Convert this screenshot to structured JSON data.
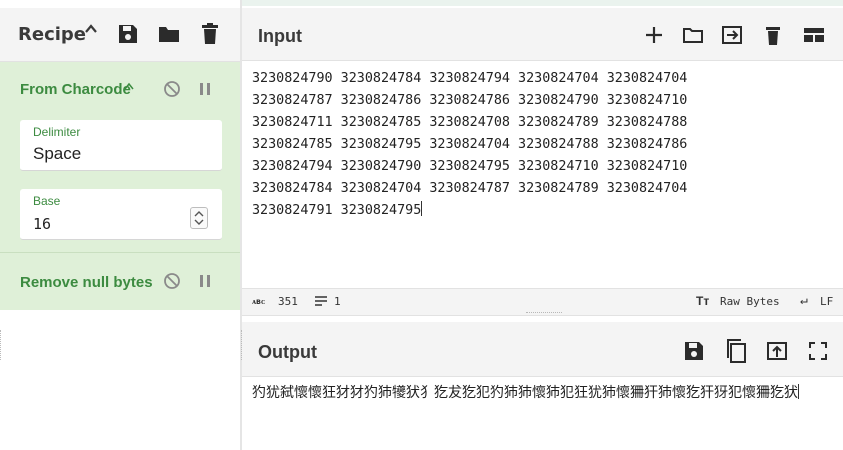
{
  "colors": {
    "accent_green": "#3c8b40",
    "operation_bg": "#dff0d8",
    "header_bg": "#f4f4f4",
    "icon_dark": "#2b2b2b"
  },
  "recipe": {
    "title": "Recipe",
    "caret_icon": "chevron-up-icon",
    "actions": [
      "save-icon",
      "folder-icon",
      "trash-icon"
    ],
    "operations": [
      {
        "name": "From Charcode",
        "controls": [
          "disable-icon",
          "pause-icon"
        ],
        "args": [
          {
            "label": "Delimiter",
            "value": "Space"
          },
          {
            "label": "Base",
            "value": "16"
          }
        ]
      },
      {
        "name": "Remove null bytes",
        "controls": [
          "disable-icon",
          "pause-icon"
        ]
      }
    ]
  },
  "input": {
    "title": "Input",
    "tools": [
      "plus-icon",
      "folder-icon",
      "import-icon",
      "trash-icon",
      "layout-icon"
    ],
    "text": "3230824790 3230824784 3230824794 3230824704 3230824704\n3230824787 3230824786 3230824786 3230824790 3230824710\n3230824711 3230824785 3230824708 3230824789 3230824788\n3230824785 3230824795 3230824704 3230824788 3230824786\n3230824794 3230824790 3230824795 3230824710 3230824710\n3230824784 3230824704 3230824787 3230824789 3230824704\n3230824791 3230824795",
    "status": {
      "length_icon": "abc-icon",
      "length": "351",
      "lines_icon": "lines-icon",
      "lines": "1",
      "encoding_icon": "text-format-icon",
      "encoding": "Raw Bytes",
      "eol_icon": "return-icon",
      "eol": "LF"
    }
  },
  "output": {
    "title": "Output",
    "tools": [
      "save-icon",
      "copy-icon",
      "replace-input-icon",
      "maximize-icon"
    ],
    "text": "犳犹弑懷懷狂犲犲犳犻犪犾犭犵犮犵犯犳犻犻懷犻犯狂犹犻懷狦犴犻懷犵犴犽犯懷狦犵犾"
  }
}
